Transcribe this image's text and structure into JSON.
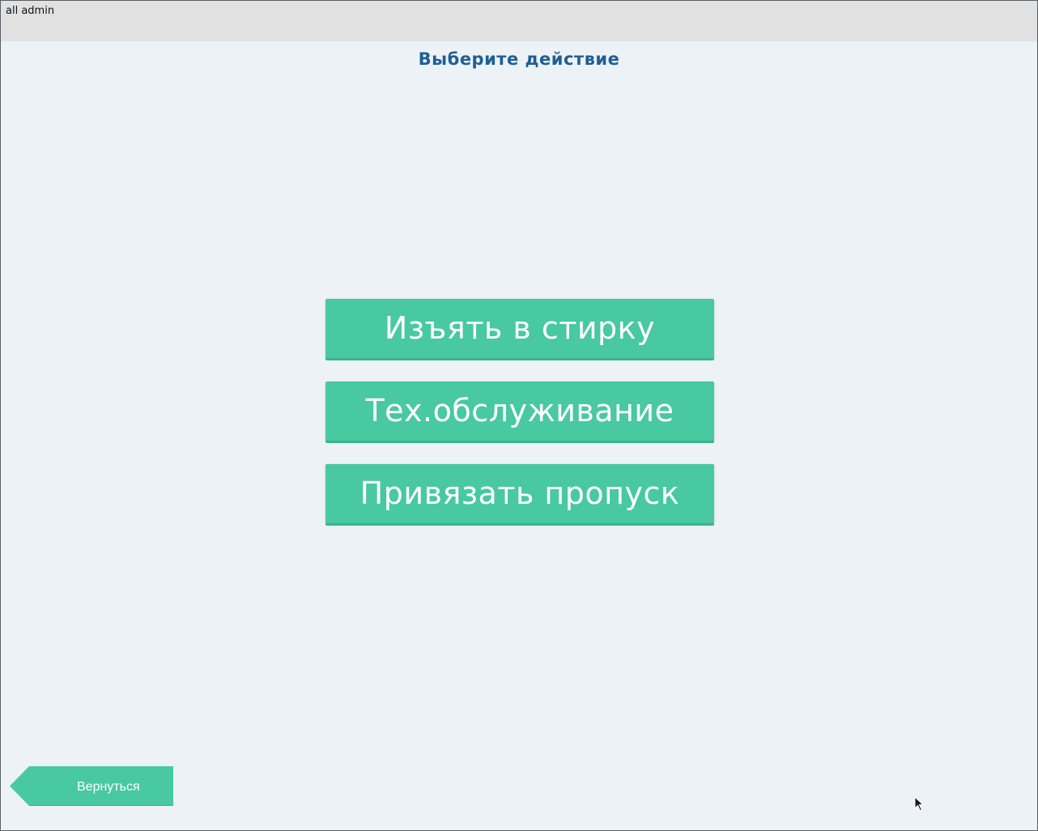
{
  "header": {
    "user_label": "all admin"
  },
  "main": {
    "title": "Выберите действие",
    "actions": [
      {
        "label": "Изъять в стирку"
      },
      {
        "label": "Тех.обслуживание"
      },
      {
        "label": "Привязать пропуск"
      }
    ]
  },
  "footer": {
    "back_label": "Вернуться"
  },
  "colors": {
    "accent": "#48c9a0",
    "title": "#1e5e94",
    "background": "#ecf2f6",
    "topbar": "#e1e1e1"
  },
  "icons": {
    "back": "back-arrow-icon",
    "cursor": "mouse-pointer-icon"
  }
}
